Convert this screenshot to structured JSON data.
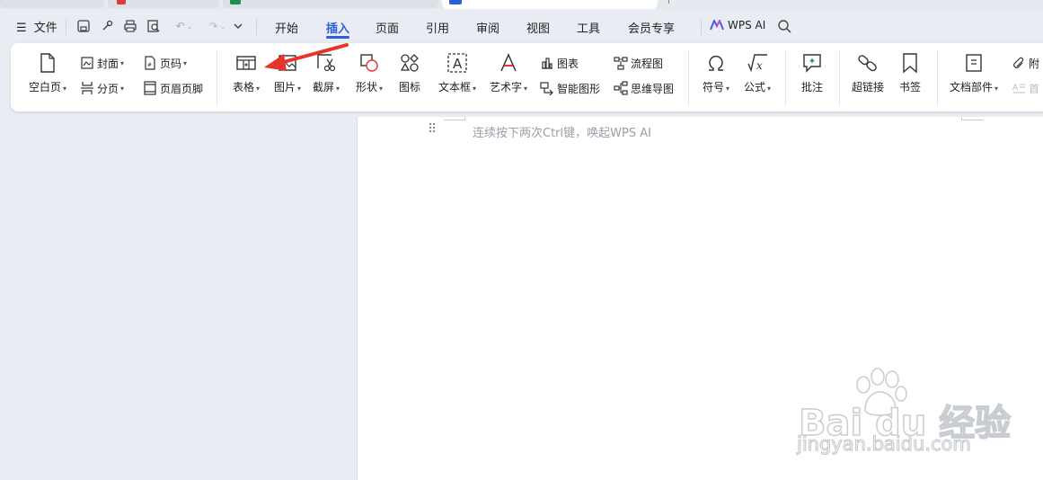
{
  "menu": {
    "file_label": "文件",
    "tabs": [
      "开始",
      "插入",
      "页面",
      "引用",
      "审阅",
      "视图",
      "工具",
      "会员专享"
    ],
    "active_tab": "插入",
    "wps_ai_label": "WPS AI"
  },
  "ribbon": {
    "blank_page": "空白页",
    "cover": "封面",
    "page_break": "分页",
    "page_number": "页码",
    "header_footer": "页眉页脚",
    "table": "表格",
    "picture": "图片",
    "screenshot": "截屏",
    "shapes": "形状",
    "icons": "图标",
    "textbox": "文本框",
    "wordart": "艺术字",
    "chart": "图表",
    "smartart": "智能图形",
    "flowchart": "流程图",
    "mindmap": "思维导图",
    "symbol": "符号",
    "formula": "公式",
    "comment": "批注",
    "hyperlink": "超链接",
    "bookmark": "书签",
    "doc_parts": "文档部件",
    "attachment": "附",
    "dropcap": "首"
  },
  "document": {
    "hint": "连续按下两次Ctrl键，唤起WPS AI"
  },
  "watermark": {
    "brand": "Bai du 经验",
    "url": "jingyan.baidu.com"
  },
  "colors": {
    "accent": "#2b5fd9",
    "annotation_arrow": "#e8352b",
    "background": "#e9edf3"
  }
}
